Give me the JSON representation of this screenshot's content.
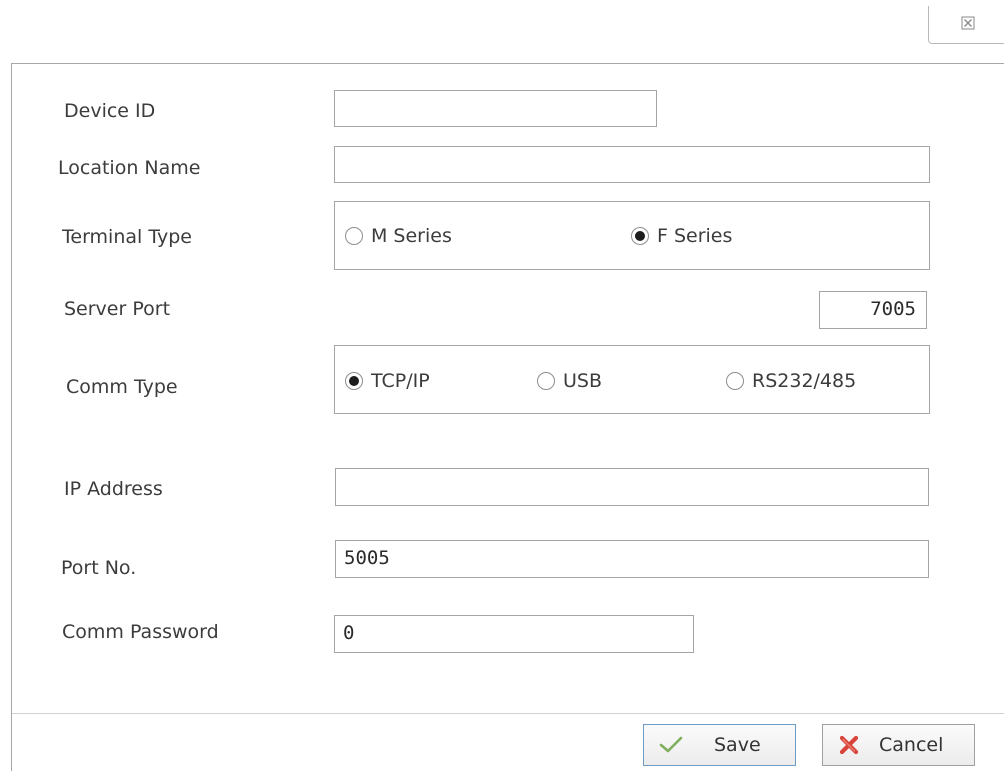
{
  "fields": {
    "device_id": {
      "label": "Device ID",
      "value": ""
    },
    "location_name": {
      "label": "Location Name",
      "value": ""
    },
    "terminal_type": {
      "label": "Terminal Type",
      "options": [
        "M Series",
        "F Series"
      ],
      "selected": "F Series"
    },
    "server_port": {
      "label": "Server Port",
      "value": "7005"
    },
    "comm_type": {
      "label": "Comm Type",
      "options": [
        "TCP/IP",
        "USB",
        "RS232/485"
      ],
      "selected": "TCP/IP"
    },
    "ip_address": {
      "label": "IP Address",
      "value": ""
    },
    "port_no": {
      "label": "Port No.",
      "value": "5005"
    },
    "comm_password": {
      "label": "Comm Password",
      "value": "0"
    }
  },
  "buttons": {
    "save_label": "Save",
    "cancel_label": "Cancel"
  },
  "icons": {
    "close": "close-icon",
    "save": "checkmark-icon",
    "cancel": "red-x-icon"
  },
  "colors": {
    "checkmark": "#7fae5c",
    "cancel_x": "#d8443a",
    "save_border": "#6d9bc4"
  }
}
